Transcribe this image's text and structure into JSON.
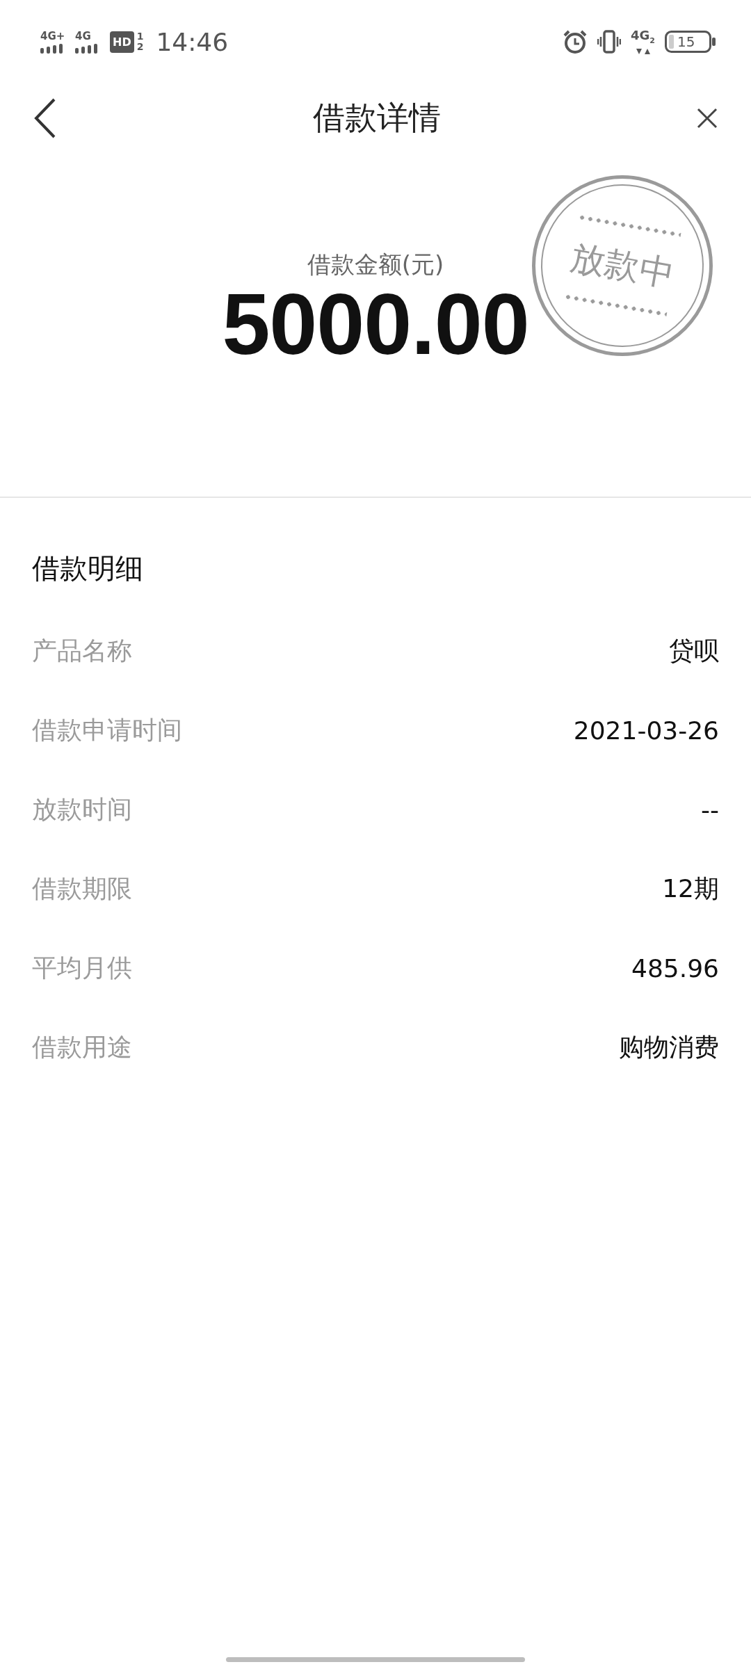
{
  "status_bar": {
    "sim1": "4G+",
    "sim2": "4G",
    "hd": "HD",
    "hd_index": [
      "1",
      "2"
    ],
    "time": "14:46",
    "network": "4G",
    "network_index": "2",
    "battery": "15"
  },
  "header": {
    "title": "借款详情"
  },
  "summary": {
    "label": "借款金额(元)",
    "amount": "5000.00",
    "stamp": "放款中"
  },
  "details": {
    "title": "借款明细",
    "rows": [
      {
        "label": "产品名称",
        "value": "贷呗"
      },
      {
        "label": "借款申请时间",
        "value": "2021-03-26"
      },
      {
        "label": "放款时间",
        "value": "--"
      },
      {
        "label": "借款期限",
        "value": "12期"
      },
      {
        "label": "平均月供",
        "value": "485.96"
      },
      {
        "label": "借款用途",
        "value": "购物消费"
      }
    ]
  }
}
